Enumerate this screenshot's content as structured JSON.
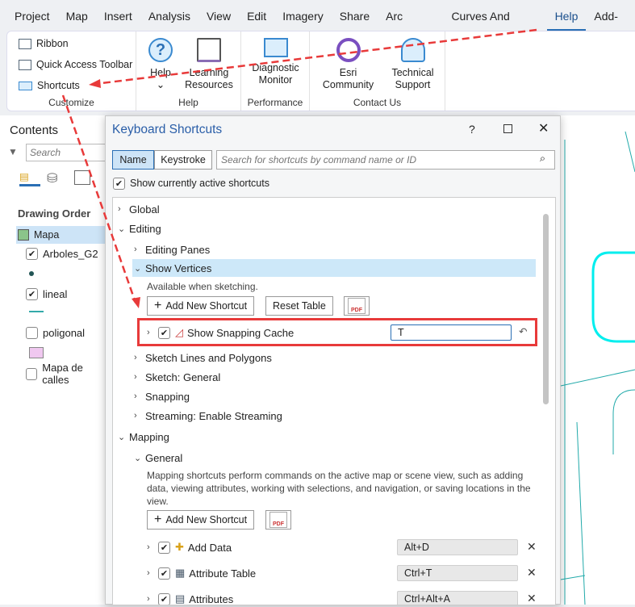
{
  "menu": [
    "Project",
    "Map",
    "Insert",
    "Analysis",
    "View",
    "Edit",
    "Imagery",
    "Share",
    "Arc Hydro",
    "Curves And Lines",
    "Help",
    "Add-In"
  ],
  "ribbon": {
    "customize": {
      "label": "Customize",
      "items": [
        "Ribbon",
        "Quick Access Toolbar",
        "Shortcuts"
      ]
    },
    "help": {
      "label": "Help",
      "help": "Help",
      "learning": [
        "Learning",
        "Resources"
      ]
    },
    "performance": {
      "label": "Performance",
      "diag": [
        "Diagnostic",
        "Monitor"
      ]
    },
    "contact": {
      "label": "Contact Us",
      "esri": [
        "Esri",
        "Community"
      ],
      "tech": [
        "Technical",
        "Support"
      ]
    }
  },
  "contents": {
    "title": "Contents",
    "search_placeholder": "Search",
    "drawing_order": "Drawing Order",
    "map": "Mapa",
    "layers": [
      "Arboles_G2",
      "lineal",
      "poligonal",
      "Mapa de calles"
    ]
  },
  "dialog": {
    "title": "Keyboard Shortcuts",
    "help": "?",
    "tab_name": "Name",
    "tab_keystroke": "Keystroke",
    "search_placeholder": "Search for shortcuts by command name or ID",
    "show_active": "Show currently active shortcuts",
    "global": "Global",
    "editing": "Editing",
    "editing_panes": "Editing Panes",
    "show_vertices": "Show Vertices",
    "available": "Available when sketching.",
    "add_new": "Add New Shortcut",
    "reset": "Reset Table",
    "pdf": "PDF",
    "snapping_cache": "Show Snapping Cache",
    "snapping_key": "T",
    "editing_children": [
      "Sketch Lines and Polygons",
      "Sketch: General",
      "Snapping",
      "Streaming: Enable Streaming"
    ],
    "mapping": "Mapping",
    "general": "General",
    "mapping_desc": "Mapping shortcuts perform commands on the active map or scene view, such as adding data, viewing attributes, working with selections, and navigation, or saving locations in the view.",
    "commands": [
      {
        "name": "Add Data",
        "key": "Alt+D"
      },
      {
        "name": "Attribute Table",
        "key": "Ctrl+T"
      },
      {
        "name": "Attributes",
        "key": "Ctrl+Alt+A"
      }
    ]
  }
}
